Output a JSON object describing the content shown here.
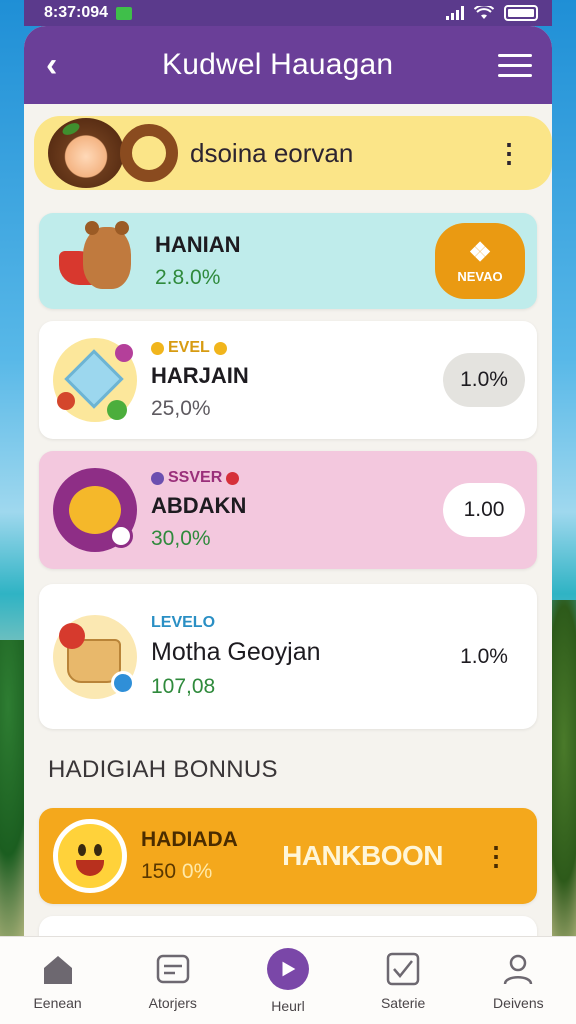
{
  "status_bar": {
    "time": "8:37:094"
  },
  "header": {
    "title": "Kudwel Hauagan"
  },
  "profile": {
    "name": "dsoina eorvan"
  },
  "cards": [
    {
      "name": "HANIAN",
      "value": "2.8.0%",
      "action": "NEVAO"
    },
    {
      "level": "EVEL",
      "name": "HARJAIN",
      "value": "25,0%",
      "action": "1.0%"
    },
    {
      "level": "SSVER",
      "name": "ABDAKN",
      "value": "30,0%",
      "action": "1.00"
    },
    {
      "level": "LEVELO",
      "name": "Motha Geoyjan",
      "value": "107,08",
      "action": "1.0%"
    }
  ],
  "section_title": "HADIGIAH BONNUS",
  "bonus": {
    "name": "HADIADA",
    "value_num": "150",
    "value_pct": "0%",
    "label": "HANKBOON"
  },
  "nav": [
    {
      "label": "Eenean",
      "icon": "home-icon"
    },
    {
      "label": "Atorjers",
      "icon": "tasks-icon"
    },
    {
      "label": "Heurl",
      "icon": "play-icon"
    },
    {
      "label": "Saterie",
      "icon": "check-icon"
    },
    {
      "label": "Deivens",
      "icon": "profile-icon"
    }
  ],
  "colors": {
    "header": "#6a3f98",
    "profile_bg": "#fbe588",
    "card_teal": "#bfeceb",
    "card_pink": "#f3c8de",
    "bonus_bg": "#f4a81c",
    "value_green": "#2f8a3c",
    "level_gold": "#d79b12",
    "level_purple": "#9a2f7a",
    "level_blue": "#2a8fc4"
  }
}
